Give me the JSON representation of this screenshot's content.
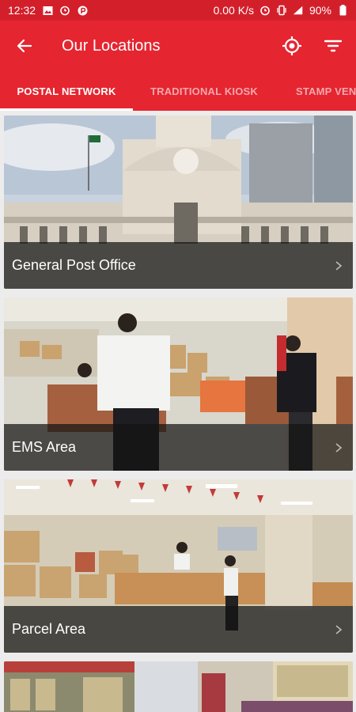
{
  "status": {
    "time": "12:32",
    "net_speed": "0.00 K/s",
    "battery": "90%"
  },
  "header": {
    "title": "Our Locations"
  },
  "tabs": [
    {
      "label": "POSTAL NETWORK",
      "active": true
    },
    {
      "label": "TRADITIONAL KIOSK",
      "active": false
    },
    {
      "label": "STAMP VENDING",
      "active": false
    }
  ],
  "locations": [
    {
      "name": "General Post Office"
    },
    {
      "name": "EMS Area"
    },
    {
      "name": "Parcel Area"
    }
  ],
  "colors": {
    "primary": "#e52530",
    "status_bar": "#d31f2a"
  }
}
